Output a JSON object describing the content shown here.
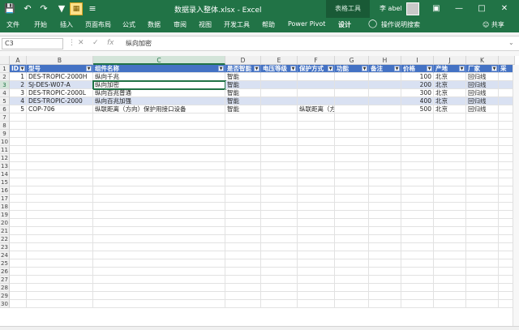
{
  "titlebar": {
    "doc_title": "数据录入整体.xlsx  -  Excel",
    "context_tools": "表格工具",
    "user": "李 abel",
    "icons": {
      "save": "save-icon",
      "undo": "undo-icon",
      "redo": "redo-icon",
      "filter": "filter-icon",
      "custom": "custom-macro-icon",
      "more": "more-icon",
      "ribbon_options": "ribbon-display-icon",
      "minimize": "minimize-icon",
      "restore": "restore-icon",
      "close": "close-icon"
    }
  },
  "ribbon": {
    "tabs": [
      "文件",
      "开始",
      "插入",
      "页面布局",
      "公式",
      "数据",
      "审阅",
      "视图",
      "开发工具",
      "帮助",
      "Power Pivot",
      "设计"
    ],
    "tell_me": "操作说明搜索",
    "share": "共享"
  },
  "formula_bar": {
    "name_box": "C3",
    "fx": "fx",
    "value": "纵向加密"
  },
  "columns": [
    "A",
    "B",
    "C",
    "D",
    "E",
    "F",
    "G",
    "H",
    "I",
    "J",
    "K"
  ],
  "table": {
    "headers": [
      "ID",
      "型号",
      "组件名称",
      "是否智能",
      "电压等级",
      "保护方式",
      "功能",
      "备注",
      "价格",
      "产地",
      "厂家",
      "采"
    ],
    "rows": [
      [
        "1",
        "DES-TROPIC-2000H",
        "纵向千兆",
        "智能",
        "",
        "",
        "",
        "",
        "100",
        "北京",
        "回归线"
      ],
      [
        "2",
        "SJ-DES-W07-A",
        "纵向加密",
        "智能",
        "",
        "",
        "",
        "",
        "200",
        "北京",
        "回归线"
      ],
      [
        "3",
        "DES-TROPIC-2000L",
        "纵向百兆普通",
        "智能",
        "",
        "",
        "",
        "",
        "300",
        "北京",
        "回归线"
      ],
      [
        "4",
        "DES-TROPIC-2000",
        "纵向百兆加强",
        "智能",
        "",
        "",
        "",
        "",
        "400",
        "北京",
        "回归线"
      ],
      [
        "5",
        "COP-706",
        "纵联距离（方向）保护用接口设备",
        "智能",
        "",
        "纵联距离（方向）保护",
        "",
        "",
        "500",
        "北京",
        "回归线"
      ]
    ]
  },
  "row_numbers": [
    "1",
    "2",
    "3",
    "4",
    "5",
    "6",
    "7",
    "8",
    "9",
    "10",
    "11",
    "12",
    "13",
    "14",
    "15",
    "16",
    "17",
    "18",
    "19",
    "20",
    "21",
    "22",
    "23",
    "24",
    "25",
    "26",
    "27",
    "28",
    "29",
    "30"
  ]
}
